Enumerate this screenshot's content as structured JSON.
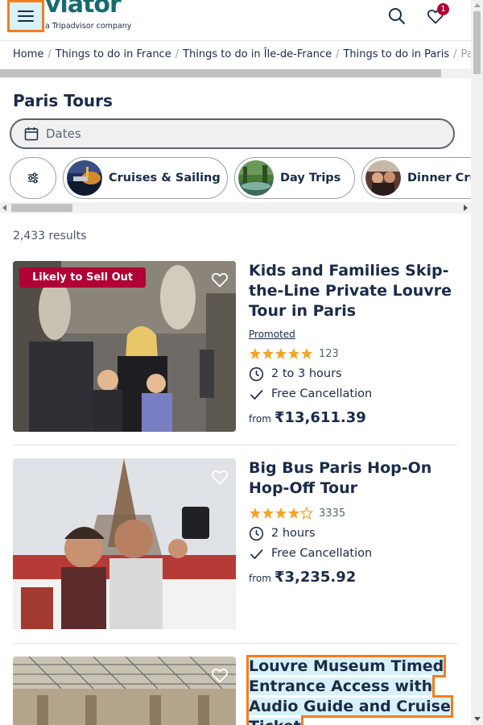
{
  "header": {
    "logo_text": "viator",
    "logo_subtitle": "a Tripadvisor company",
    "wishlist_count": "1",
    "icons": [
      "menu-icon",
      "search-icon",
      "heart-icon"
    ]
  },
  "breadcrumbs": [
    {
      "label": "Home"
    },
    {
      "label": "Things to do in France"
    },
    {
      "label": "Things to do in Île-de-France"
    },
    {
      "label": "Things to do in Paris"
    },
    {
      "label": "Paris Tours"
    }
  ],
  "page": {
    "title": "Paris Tours",
    "dates_label": "Dates",
    "results_count": "2,433 results"
  },
  "filters": {
    "chips": [
      {
        "label": "Cruises & Sailing"
      },
      {
        "label": "Day Trips"
      },
      {
        "label": "Dinner Cruises"
      }
    ]
  },
  "listings": [
    {
      "badge": "Likely to Sell Out",
      "title": "Kids and Families Skip-the-Line Private Louvre Tour in Paris",
      "promoted": "Promoted",
      "rating": 5,
      "reviews": "123",
      "duration": "2 to 3 hours",
      "cancellation": "Free Cancellation",
      "price_prefix": "from",
      "price": "₹13,611.39"
    },
    {
      "title": "Big Bus Paris Hop-On Hop-Off Tour",
      "rating": 4,
      "reviews": "3335",
      "duration": "2 hours",
      "cancellation": "Free Cancellation",
      "price_prefix": "from",
      "price": "₹3,235.92"
    },
    {
      "title": "Louvre Museum Timed Entrance Access with Audio Guide and Cruise Ticket"
    }
  ],
  "colors": {
    "brand": "#186b6d",
    "text": "#1a2b49",
    "badge": "#b00034",
    "star": "#f2a52b",
    "highlight_outline": "#f47d1e",
    "highlight_fill": "#d7f1f8"
  }
}
